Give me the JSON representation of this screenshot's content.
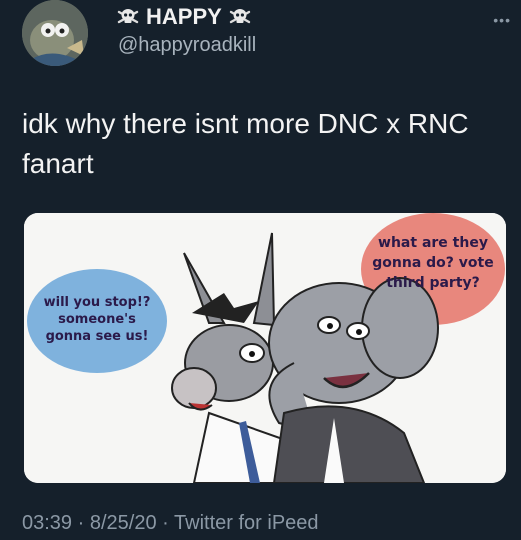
{
  "author": {
    "display_name": "HAPPY",
    "handle": "@happyroadkill",
    "avatar_icon": "avatar-image",
    "badge_icon": "skull-crossbones-icon"
  },
  "tweet": {
    "text": "idk why there isnt more DNC x RNC fanart",
    "media": {
      "left_bubble": [
        "will you stop!?",
        "someone's",
        "gonna see us!"
      ],
      "right_bubble": [
        "what are they",
        "gonna do? vote",
        "third party?"
      ]
    }
  },
  "meta": {
    "time": "03:39",
    "date": "8/25/20",
    "source": "Twitter for iPeed",
    "separator": "·"
  },
  "colors": {
    "background": "#15202b",
    "text": "#e7e9ea",
    "muted": "#8b98a5",
    "blue_bubble": "#7fb2dd",
    "red_bubble": "#e8877d"
  }
}
